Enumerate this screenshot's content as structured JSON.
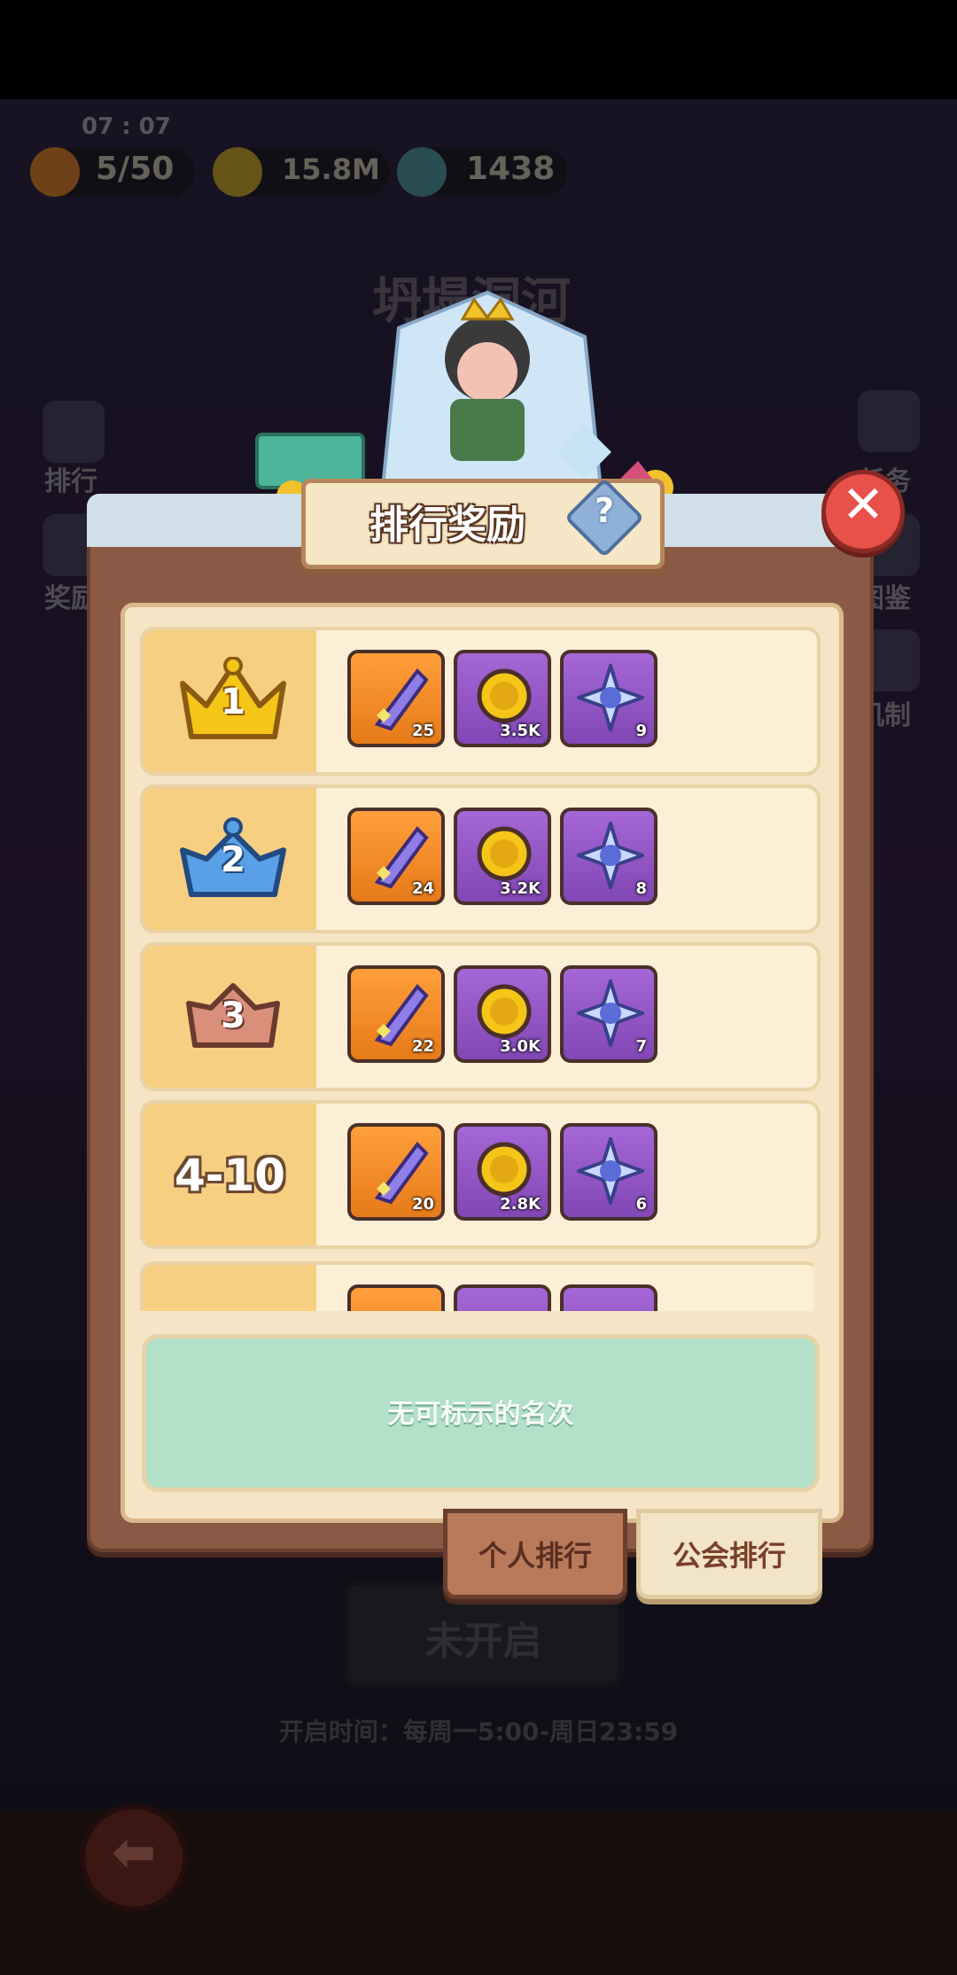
{
  "status": {
    "time": "07 : 07"
  },
  "resources": [
    {
      "icon": "fire-icon",
      "value": "5/50"
    },
    {
      "icon": "gold-coin-icon",
      "value": "15.8M"
    },
    {
      "icon": "crystal-icon",
      "value": "1438"
    }
  ],
  "event": {
    "title": "坍塌洞河"
  },
  "side_left": [
    {
      "icon": "ranking-icon",
      "label": "排行"
    },
    {
      "icon": "reward-icon",
      "label": "奖励"
    }
  ],
  "side_right": [
    {
      "icon": "task-icon",
      "label": "任务"
    },
    {
      "icon": "codex-icon",
      "label": "图鉴"
    },
    {
      "icon": "gamepad-icon",
      "label": "机制"
    }
  ],
  "panel": {
    "title": "排行奖励",
    "help": "?",
    "close": "✕",
    "rows": [
      {
        "rank": "1",
        "rank_icon": "gold-crown-icon",
        "items": [
          {
            "icon": "feather-icon",
            "qty": "25"
          },
          {
            "icon": "gold-coin-icon",
            "qty": "3.5K"
          },
          {
            "icon": "blue-crystal-icon",
            "qty": "9"
          }
        ]
      },
      {
        "rank": "2",
        "rank_icon": "blue-crown-icon",
        "items": [
          {
            "icon": "feather-icon",
            "qty": "24"
          },
          {
            "icon": "gold-coin-icon",
            "qty": "3.2K"
          },
          {
            "icon": "blue-crystal-icon",
            "qty": "8"
          }
        ]
      },
      {
        "rank": "3",
        "rank_icon": "bronze-crown-icon",
        "items": [
          {
            "icon": "feather-icon",
            "qty": "22"
          },
          {
            "icon": "gold-coin-icon",
            "qty": "3.0K"
          },
          {
            "icon": "blue-crystal-icon",
            "qty": "7"
          }
        ]
      },
      {
        "rank": "4-10",
        "rank_icon": "",
        "items": [
          {
            "icon": "feather-icon",
            "qty": "20"
          },
          {
            "icon": "gold-coin-icon",
            "qty": "2.8K"
          },
          {
            "icon": "blue-crystal-icon",
            "qty": "6"
          }
        ]
      }
    ],
    "my_rank": "无可标示的名次",
    "tabs": [
      "个人排行",
      "公会排行"
    ]
  },
  "buttons": {
    "not_open": "未开启"
  },
  "open_time": "开启时间：每周一5:00-周日23:59",
  "colors": {
    "orange_item": "#f08a26",
    "purple_item": "#9556c6",
    "panel_brown": "#8b5a45",
    "mint": "#b2e0c8",
    "close_red": "#e8504a"
  }
}
